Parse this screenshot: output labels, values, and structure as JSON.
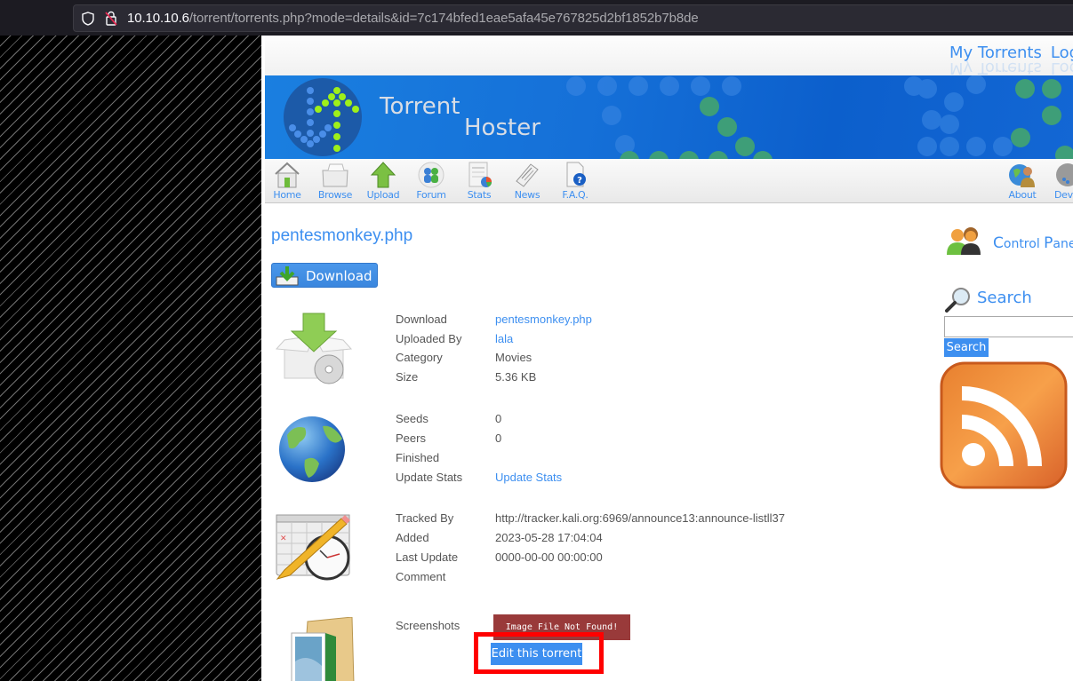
{
  "browser": {
    "url_host": "10.10.10.6",
    "url_path": "/torrent/torrents.php?mode=details&id=7c174bfed1eae5afa45e767825d2bf1852b7b8de"
  },
  "header": {
    "links": [
      "My Torrents",
      "Log"
    ],
    "brand_line1": "Torrent",
    "brand_line2": "Hoster"
  },
  "nav": {
    "items": [
      {
        "label": "Home",
        "icon": "home-icon"
      },
      {
        "label": "Browse",
        "icon": "browse-icon"
      },
      {
        "label": "Upload",
        "icon": "upload-icon"
      },
      {
        "label": "Forum",
        "icon": "forum-icon"
      },
      {
        "label": "Stats",
        "icon": "stats-icon"
      },
      {
        "label": "News",
        "icon": "news-icon"
      },
      {
        "label": "F.A.Q.",
        "icon": "faq-icon"
      }
    ],
    "right_items": [
      {
        "label": "About",
        "icon": "about-icon"
      },
      {
        "label": "Devel",
        "icon": "developers-icon"
      }
    ]
  },
  "torrent": {
    "title": "pentesmonkey.php",
    "download_button": "Download",
    "sections": {
      "file": [
        {
          "label": "Download",
          "value": "pentesmonkey.php",
          "link": true
        },
        {
          "label": "Uploaded By",
          "value": "lala",
          "link": true
        },
        {
          "label": "Category",
          "value": "Movies",
          "link": false
        },
        {
          "label": "Size",
          "value": "5.36 KB",
          "link": false
        }
      ],
      "stats": [
        {
          "label": "Seeds",
          "value": "0",
          "link": false
        },
        {
          "label": "Peers",
          "value": "0",
          "link": false
        },
        {
          "label": "Finished",
          "value": "",
          "link": false
        },
        {
          "label": "Update Stats",
          "value": "Update Stats",
          "link": true
        }
      ],
      "tracking": [
        {
          "label": "Tracked By",
          "value": "http://tracker.kali.org:6969/announce13:announce-listll37",
          "link": false
        },
        {
          "label": "Added",
          "value": "2023-05-28 17:04:04",
          "link": false
        },
        {
          "label": "Last Update",
          "value": "0000-00-00 00:00:00",
          "link": false
        },
        {
          "label": "Comment",
          "value": "",
          "link": false
        }
      ],
      "screenshots": {
        "label": "Screenshots",
        "missing_text": "Image File Not Found!",
        "edit_button": "Edit this torrent"
      }
    }
  },
  "sidebar": {
    "control_panel_first": "C",
    "control_panel_rest1": "ontrol ",
    "control_panel_p": "P",
    "control_panel_rest2": "anel",
    "search_title": "Search",
    "search_value": "",
    "search_button": "Search"
  },
  "colors": {
    "accent": "#3d8ff0",
    "error_bg": "#993a3a",
    "highlight": "#ff0000"
  }
}
